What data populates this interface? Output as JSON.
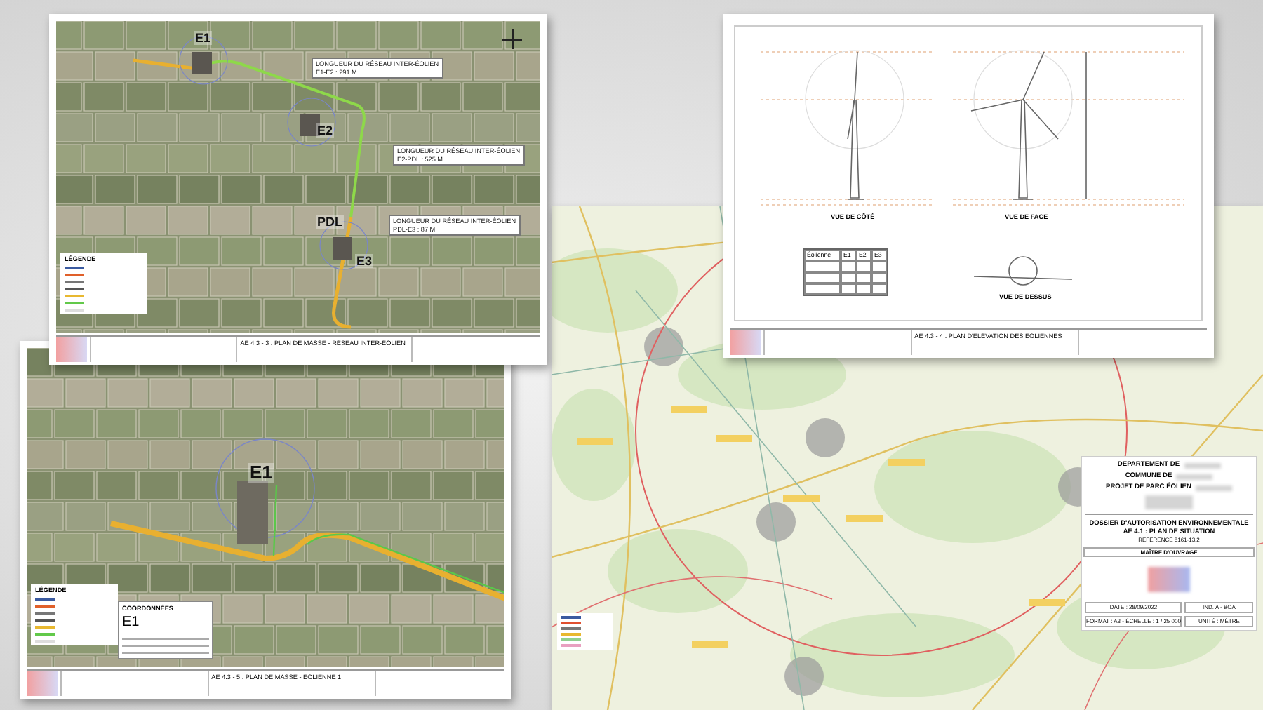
{
  "documents": [
    {
      "kind": "aerial-plan",
      "markers": [
        "E1",
        "E2",
        "PDL",
        "E3"
      ],
      "callouts": [
        {
          "title": "LONGUEUR DU RÉSEAU INTER-ÉOLIEN",
          "value": "E1-E2 : 291 M"
        },
        {
          "title": "LONGUEUR DU RÉSEAU INTER-ÉOLIEN",
          "value": "E2-PDL : 525 M"
        },
        {
          "title": "LONGUEUR DU RÉSEAU INTER-ÉOLIEN",
          "value": "PDL-E3 : 87 M"
        }
      ],
      "legend_title": "LÉGENDE",
      "plan_title": "AE 4.3 - 3 : PLAN DE MASSE - RÉSEAU INTER-ÉOLIEN"
    },
    {
      "kind": "elevation",
      "views": [
        "VUE DE CÔTÉ",
        "VUE DE FACE",
        "VUE DE DESSUS"
      ],
      "table_header": [
        "Éolienne",
        "E1",
        "E2",
        "E3"
      ],
      "plan_title": "AE 4.3 - 4 : PLAN D'ÉLÉVATION DES ÉOLIENNES"
    },
    {
      "kind": "detail-plan",
      "markers": [
        "E1"
      ],
      "legend_title": "LÉGENDE",
      "coordinates": {
        "title": "COORDONNÉES",
        "turbine": "E1"
      },
      "plan_title": "AE 4.3 - 5 : PLAN DE MASSE - ÉOLIENNE 1"
    },
    {
      "kind": "situation-map",
      "title_block": {
        "lines": [
          "DEPARTEMENT DE",
          "COMMUNE DE",
          "PROJET DE PARC ÉOLIEN"
        ],
        "dossier": [
          "DOSSIER D'AUTORISATION ENVIRONNEMENTALE",
          "AE 4.1 : PLAN DE SITUATION",
          "RÉFÉRENCE 8161-13.2"
        ],
        "client_label": "MAÎTRE D'OUVRAGE",
        "footer": [
          "DATE : 28/09/2022",
          "IND. A - BOA",
          "FORMAT : A3 - ÉCHELLE : 1 / 25 000",
          "UNITÉ : MÈTRE"
        ]
      }
    }
  ]
}
